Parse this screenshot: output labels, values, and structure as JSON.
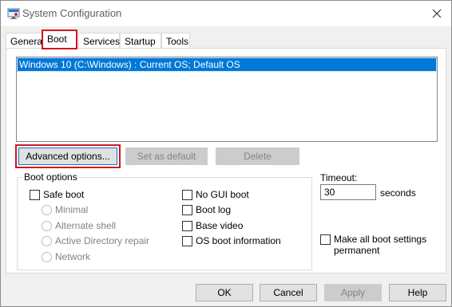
{
  "window": {
    "title": "System Configuration",
    "close_glyph": "✕"
  },
  "tabs": [
    {
      "label": "General"
    },
    {
      "label": "Boot"
    },
    {
      "label": "Services"
    },
    {
      "label": "Startup"
    },
    {
      "label": "Tools"
    }
  ],
  "boot": {
    "os_entries": [
      "Windows 10 (C:\\Windows) : Current OS; Default OS"
    ],
    "buttons": {
      "advanced": "Advanced options...",
      "set_default": "Set as default",
      "delete": "Delete"
    },
    "boot_options": {
      "label": "Boot options",
      "safe_boot": "Safe boot",
      "radios": [
        "Minimal",
        "Alternate shell",
        "Active Directory repair",
        "Network"
      ],
      "no_gui_boot": "No GUI boot",
      "boot_log": "Boot log",
      "base_video": "Base video",
      "os_boot_info": "OS boot information"
    },
    "timeout": {
      "label": "Timeout:",
      "value": "30",
      "unit": "seconds"
    },
    "make_permanent": "Make all boot settings permanent"
  },
  "footer": {
    "ok": "OK",
    "cancel": "Cancel",
    "apply": "Apply",
    "help": "Help"
  },
  "colors": {
    "selection": "#0078d7",
    "highlight_box": "#d0161f"
  }
}
